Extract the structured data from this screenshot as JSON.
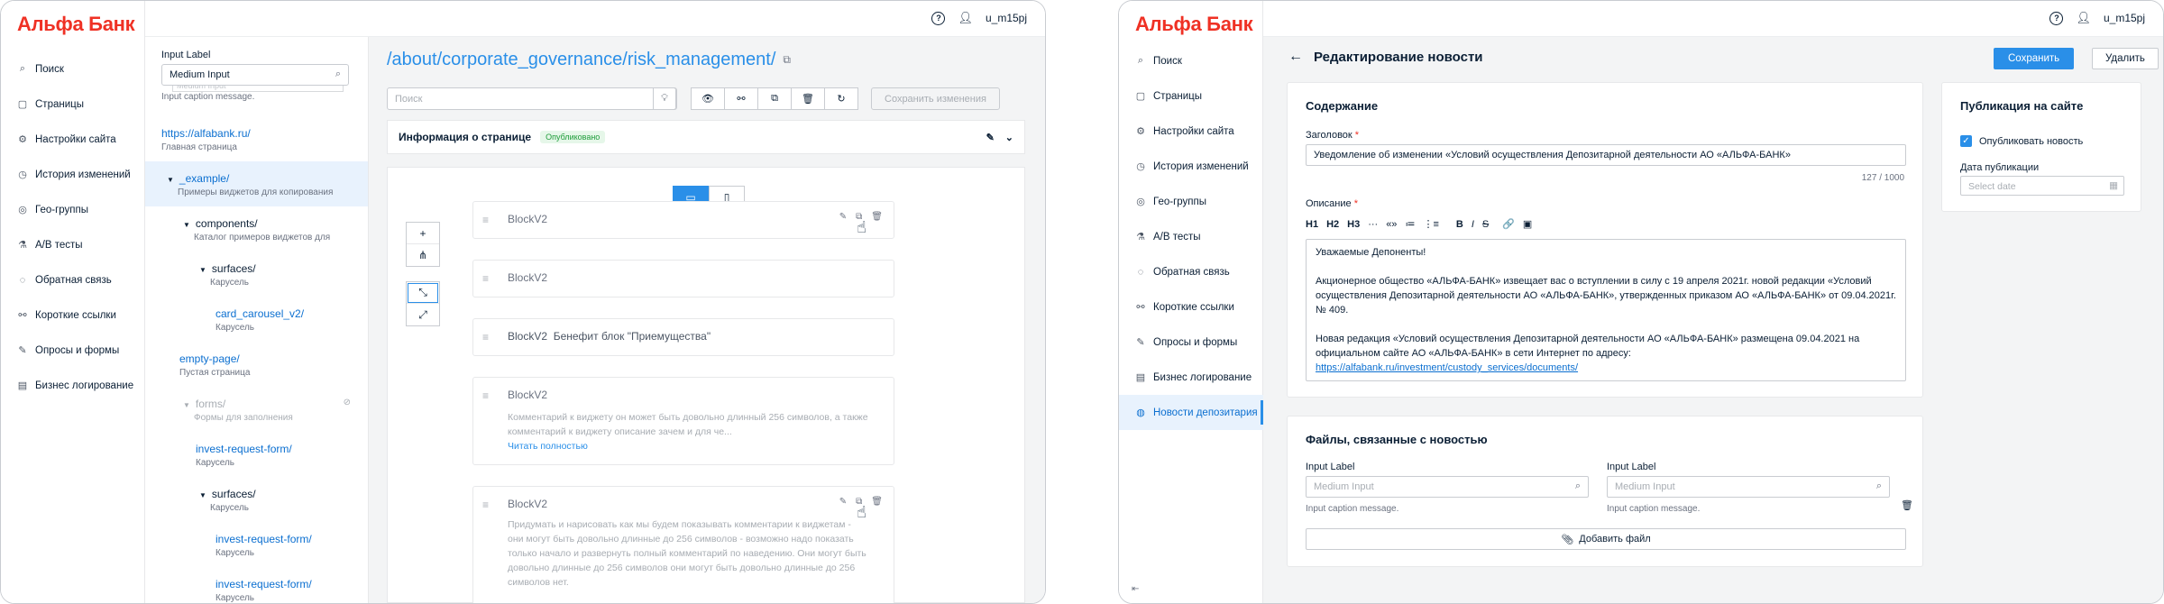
{
  "brand": "Альфа Банк",
  "user": {
    "name": "u_m15pj",
    "help_icon": "help-icon",
    "user_icon": "user-icon"
  },
  "nav1": [
    {
      "label": "Поиск",
      "icon": "search"
    },
    {
      "label": "Страницы",
      "icon": "page"
    },
    {
      "label": "Настройки сайта",
      "icon": "gear"
    },
    {
      "label": "История изменений",
      "icon": "history"
    },
    {
      "label": "Гео-группы",
      "icon": "geo"
    },
    {
      "label": "A/B тесты",
      "icon": "flask"
    },
    {
      "label": "Обратная связь",
      "icon": "feedback"
    },
    {
      "label": "Короткие ссылки",
      "icon": "link"
    },
    {
      "label": "Опросы и формы",
      "icon": "form"
    },
    {
      "label": "Бизнес логирование",
      "icon": "log"
    }
  ],
  "nav2": [
    {
      "label": "Поиск"
    },
    {
      "label": "Страницы"
    },
    {
      "label": "Настройки сайта"
    },
    {
      "label": "История изменений"
    },
    {
      "label": "Гео-группы"
    },
    {
      "label": "A/B тесты"
    },
    {
      "label": "Обратная связь"
    },
    {
      "label": "Короткие ссылки"
    },
    {
      "label": "Опросы и формы"
    },
    {
      "label": "Бизнес логирование"
    },
    {
      "label": "Новости депозитария"
    }
  ],
  "tree": {
    "input_label": "Input Label",
    "input_value": "Medium Input",
    "ghost": "Medium Input",
    "caption": "Input caption message.",
    "nodes": [
      {
        "title": "https://alfabank.ru/",
        "sub": "Главная страница"
      },
      {
        "title": "_example/",
        "sub": "Примеры виджетов для копирования"
      },
      {
        "title": "components/",
        "sub": "Каталог примеров виджетов для"
      },
      {
        "title": "surfaces/",
        "sub": "Карусель"
      },
      {
        "title": "card_carousel_v2/",
        "sub": "Карусель"
      },
      {
        "title": "empty-page/",
        "sub": "Пустая страница"
      },
      {
        "title": "forms/",
        "sub": "Формы для заполнения"
      },
      {
        "title": "invest-request-form/",
        "sub": "Карусель"
      },
      {
        "title": "surfaces/",
        "sub": "Карусель"
      },
      {
        "title": "invest-request-form/",
        "sub": "Карусель"
      },
      {
        "title": "invest-request-form/",
        "sub": "Карусель"
      }
    ]
  },
  "page": {
    "url": "/about/corporate_governance/risk_management/",
    "search_placeholder": "Поиск",
    "save_label": "Сохранить изменения",
    "info_title": "Информация о странице",
    "status": "Опубликовано"
  },
  "blocks": [
    {
      "name": "BlockV2",
      "extra": "",
      "desc": "",
      "more": ""
    },
    {
      "name": "BlockV2",
      "extra": "",
      "desc": "",
      "more": ""
    },
    {
      "name": "BlockV2",
      "extra": "Бенефит блок \"Приемущества\"",
      "desc": "",
      "more": ""
    },
    {
      "name": "BlockV2",
      "extra": "",
      "desc": "Комментарий к виджету он может быть довольно длинный 256 символов, а также комментарий к виджету описание зачем и для че...",
      "more": "Читать полностью"
    },
    {
      "name": "BlockV2",
      "extra": "",
      "desc": "Придумать и нарисовать как мы будем показывать комментарии к виджетам - они могут быть довольно длинные до 256 символов - возможно надо показать только начало и развернуть полный комментарий по наведению. Они могут быть довольно длинные до 256 символов они могут быть довольно длинные до 256 символов нет.",
      "more": ""
    }
  ],
  "news": {
    "title": "Редактирование новости",
    "save": "Сохранить",
    "delete": "Удалить",
    "content_title": "Содержание",
    "heading_label": "Заголовок",
    "heading_value": "Уведомление об изменении «Условий осуществления Депозитарной деятельности АО «АЛЬФА-БАНК»",
    "counter": "127 / 1000",
    "desc_label": "Описание",
    "rte": [
      "H1",
      "H2",
      "H3",
      "···",
      "«»",
      "≔",
      "⋮≡",
      "B",
      "I",
      "S",
      "🔗",
      "▣"
    ],
    "body": [
      "Уважаемые Депоненты!",
      "",
      "Акционерное общество «АЛЬФА-БАНК» извещает вас о вступлении в силу с 19 апреля 2021г. новой редакции «Условий осуществления Депозитарной деятельности АО «АЛЬФА-БАНК», утвержденных приказом АО «АЛЬФА-БАНК» от 09.04.2021г. № 409.",
      "",
      "Новая редакция «Условий осуществления Депозитарной деятельности АО «АЛЬФА-БАНК» размещена 09.04.2021 на официальном сайте АО «АЛЬФА-БАНК» в сети Интернет по адресу:"
    ],
    "body_link": "https://alfabank.ru/investment/custody_services/documents/",
    "publish_title": "Публикация на сайте",
    "publish_check": "Опубликовать новость",
    "date_label": "Дата публикации",
    "date_placeholder": "Select date",
    "files_title": "Файлы, связанные с новостью",
    "file_inputs": [
      {
        "label": "Input Label",
        "placeholder": "Medium Input",
        "caption": "Input caption message."
      },
      {
        "label": "Input Label",
        "placeholder": "Medium Input",
        "caption": "Input caption message."
      }
    ],
    "add_file": "Добавить файл"
  }
}
